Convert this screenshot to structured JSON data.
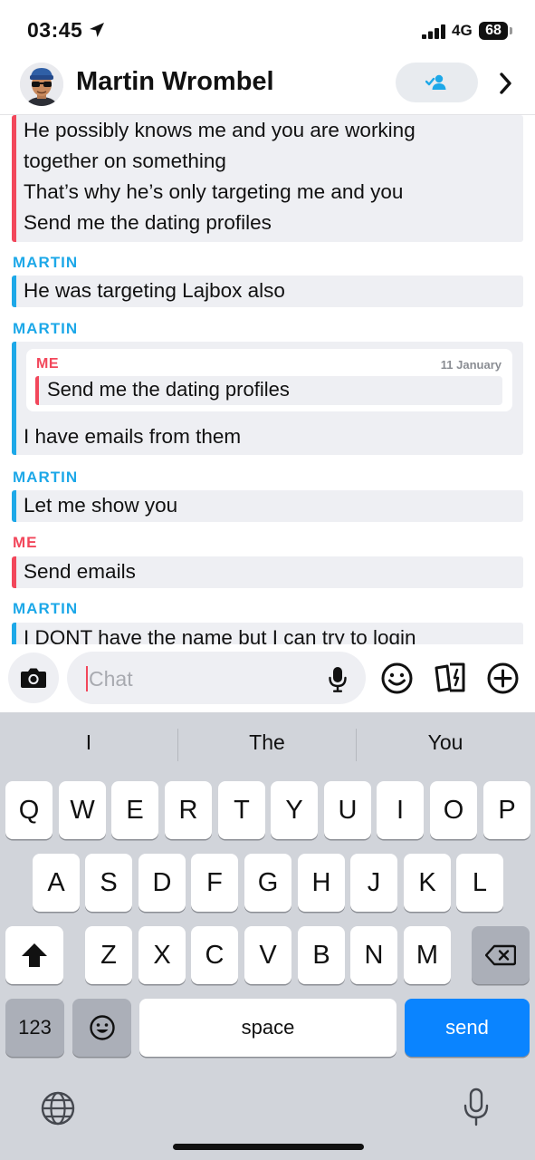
{
  "status_bar": {
    "time": "03:45",
    "network": "4G",
    "battery": "68"
  },
  "header": {
    "contact_name": "Martin Wrombel"
  },
  "colors": {
    "me": "#f2475b",
    "them": "#1da8e8",
    "send": "#0a84ff"
  },
  "messages": {
    "m1": {
      "sender": "me",
      "lines": [
        "He possibly knows me and you are working",
        "together on something",
        "That’s why he’s only targeting me and you",
        "Send me the dating profiles"
      ]
    },
    "m2": {
      "sender_label": "MARTIN",
      "text": "He was targeting Lajbox also"
    },
    "m3": {
      "sender_label": "MARTIN",
      "quote": {
        "sender": "ME",
        "date": "11 January",
        "text": "Send me the dating profiles"
      },
      "text": "I have emails from them"
    },
    "m4": {
      "sender_label": "MARTIN",
      "text": "Let me show you"
    },
    "m5": {
      "sender_label": "ME",
      "text": "Send emails"
    },
    "m6": {
      "sender_label": "MARTIN",
      "text": "I DONT have the name but I can try to login"
    }
  },
  "composer": {
    "placeholder": "Chat"
  },
  "keyboard": {
    "suggestions": [
      "I",
      "The",
      "You"
    ],
    "row1": [
      "Q",
      "W",
      "E",
      "R",
      "T",
      "Y",
      "U",
      "I",
      "O",
      "P"
    ],
    "row2": [
      "A",
      "S",
      "D",
      "F",
      "G",
      "H",
      "J",
      "K",
      "L"
    ],
    "row3": [
      "Z",
      "X",
      "C",
      "V",
      "B",
      "N",
      "M"
    ],
    "numbers_label": "123",
    "space_label": "space",
    "send_label": "send"
  },
  "icons": [
    "location-arrow-icon",
    "signal-icon",
    "add-friend-icon",
    "chevron-right-icon",
    "camera-icon",
    "microphone-icon",
    "emoji-icon",
    "cards-icon",
    "plus-icon",
    "shift-icon",
    "backspace-icon",
    "globe-icon",
    "dictation-icon"
  ]
}
